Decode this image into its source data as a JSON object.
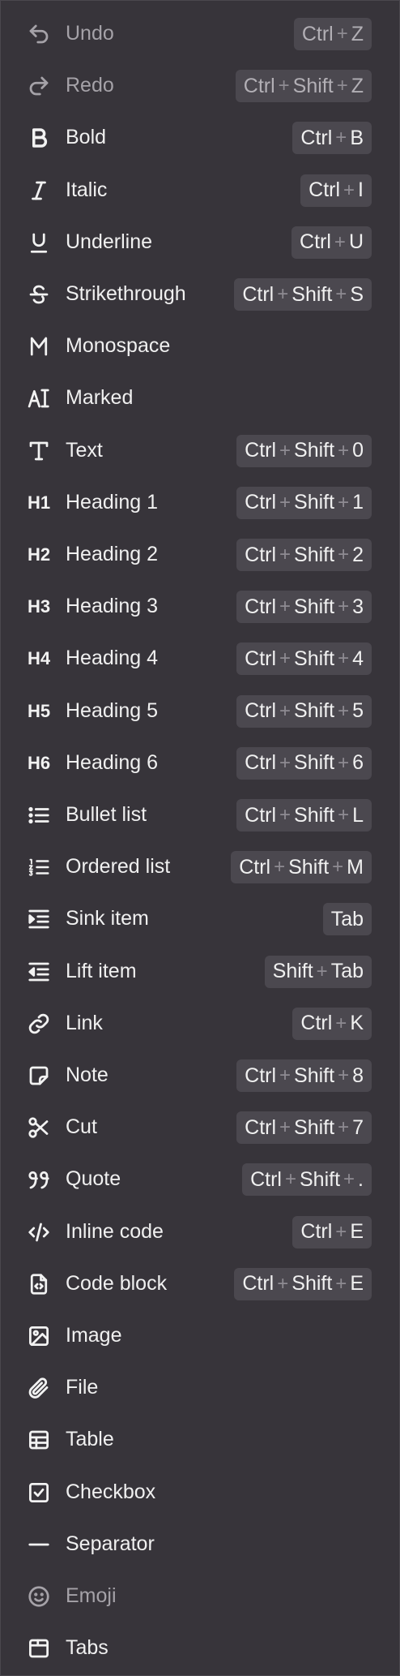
{
  "items": [
    {
      "id": "undo",
      "label": "Undo",
      "icon": "undo-icon",
      "keys": [
        "Ctrl",
        "Z"
      ],
      "disabled": true
    },
    {
      "id": "redo",
      "label": "Redo",
      "icon": "redo-icon",
      "keys": [
        "Ctrl",
        "Shift",
        "Z"
      ],
      "disabled": true
    },
    {
      "id": "bold",
      "label": "Bold",
      "icon": "bold-icon",
      "keys": [
        "Ctrl",
        "B"
      ]
    },
    {
      "id": "italic",
      "label": "Italic",
      "icon": "italic-icon",
      "keys": [
        "Ctrl",
        "I"
      ]
    },
    {
      "id": "underline",
      "label": "Underline",
      "icon": "underline-icon",
      "keys": [
        "Ctrl",
        "U"
      ]
    },
    {
      "id": "strikethrough",
      "label": "Strikethrough",
      "icon": "strikethrough-icon",
      "keys": [
        "Ctrl",
        "Shift",
        "S"
      ]
    },
    {
      "id": "monospace",
      "label": "Monospace",
      "icon": "monospace-icon",
      "keys": []
    },
    {
      "id": "marked",
      "label": "Marked",
      "icon": "marked-icon",
      "keys": []
    },
    {
      "id": "text",
      "label": "Text",
      "icon": "text-icon",
      "keys": [
        "Ctrl",
        "Shift",
        "0"
      ]
    },
    {
      "id": "heading-1",
      "label": "Heading 1",
      "icon": "heading-1-icon",
      "icon_text": "H1",
      "keys": [
        "Ctrl",
        "Shift",
        "1"
      ]
    },
    {
      "id": "heading-2",
      "label": "Heading 2",
      "icon": "heading-2-icon",
      "icon_text": "H2",
      "keys": [
        "Ctrl",
        "Shift",
        "2"
      ]
    },
    {
      "id": "heading-3",
      "label": "Heading 3",
      "icon": "heading-3-icon",
      "icon_text": "H3",
      "keys": [
        "Ctrl",
        "Shift",
        "3"
      ]
    },
    {
      "id": "heading-4",
      "label": "Heading 4",
      "icon": "heading-4-icon",
      "icon_text": "H4",
      "keys": [
        "Ctrl",
        "Shift",
        "4"
      ]
    },
    {
      "id": "heading-5",
      "label": "Heading 5",
      "icon": "heading-5-icon",
      "icon_text": "H5",
      "keys": [
        "Ctrl",
        "Shift",
        "5"
      ]
    },
    {
      "id": "heading-6",
      "label": "Heading 6",
      "icon": "heading-6-icon",
      "icon_text": "H6",
      "keys": [
        "Ctrl",
        "Shift",
        "6"
      ]
    },
    {
      "id": "bullet-list",
      "label": "Bullet list",
      "icon": "bullet-list-icon",
      "keys": [
        "Ctrl",
        "Shift",
        "L"
      ]
    },
    {
      "id": "ordered-list",
      "label": "Ordered list",
      "icon": "ordered-list-icon",
      "keys": [
        "Ctrl",
        "Shift",
        "M"
      ]
    },
    {
      "id": "sink-item",
      "label": "Sink item",
      "icon": "indent-icon",
      "keys": [
        "Tab"
      ]
    },
    {
      "id": "lift-item",
      "label": "Lift item",
      "icon": "outdent-icon",
      "keys": [
        "Shift",
        "Tab"
      ]
    },
    {
      "id": "link",
      "label": "Link",
      "icon": "link-icon",
      "keys": [
        "Ctrl",
        "K"
      ]
    },
    {
      "id": "note",
      "label": "Note",
      "icon": "note-icon",
      "keys": [
        "Ctrl",
        "Shift",
        "8"
      ]
    },
    {
      "id": "cut",
      "label": "Cut",
      "icon": "scissors-icon",
      "keys": [
        "Ctrl",
        "Shift",
        "7"
      ]
    },
    {
      "id": "quote",
      "label": "Quote",
      "icon": "quote-icon",
      "keys": [
        "Ctrl",
        "Shift",
        "."
      ]
    },
    {
      "id": "inline-code",
      "label": "Inline code",
      "icon": "code-icon",
      "keys": [
        "Ctrl",
        "E"
      ]
    },
    {
      "id": "code-block",
      "label": "Code block",
      "icon": "code-file-icon",
      "keys": [
        "Ctrl",
        "Shift",
        "E"
      ]
    },
    {
      "id": "image",
      "label": "Image",
      "icon": "image-icon",
      "keys": []
    },
    {
      "id": "file",
      "label": "File",
      "icon": "paperclip-icon",
      "keys": []
    },
    {
      "id": "table",
      "label": "Table",
      "icon": "table-icon",
      "keys": []
    },
    {
      "id": "checkbox",
      "label": "Checkbox",
      "icon": "checkbox-icon",
      "keys": []
    },
    {
      "id": "separator",
      "label": "Separator",
      "icon": "separator-icon",
      "keys": []
    },
    {
      "id": "emoji",
      "label": "Emoji",
      "icon": "emoji-icon",
      "keys": [],
      "disabled": true
    },
    {
      "id": "tabs",
      "label": "Tabs",
      "icon": "tabs-icon",
      "keys": []
    }
  ],
  "key_separator": "+"
}
